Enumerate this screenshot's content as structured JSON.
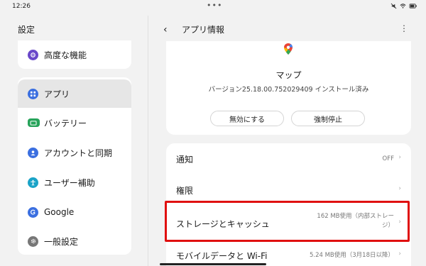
{
  "status_bar": {
    "time": "12:26",
    "dots": "•••"
  },
  "sidebar": {
    "title": "設定",
    "items": [
      {
        "label": "高度な機能",
        "icon": "advanced-features-icon",
        "color": "#6a48c9"
      },
      {
        "label": "アプリ",
        "icon": "apps-grid-icon",
        "color": "#3b6fe0",
        "active": true
      },
      {
        "label": "バッテリー",
        "icon": "battery-icon",
        "color": "#27a35a"
      },
      {
        "label": "アカウントと同期",
        "icon": "account-icon",
        "color": "#3b6fe0"
      },
      {
        "label": "ユーザー補助",
        "icon": "accessibility-icon",
        "color": "#1aa3c7"
      },
      {
        "label": "Google",
        "icon": "google-icon",
        "color": "#3b6fe0"
      },
      {
        "label": "一般設定",
        "icon": "gear-icon",
        "color": "#777777"
      }
    ]
  },
  "header": {
    "back": "‹",
    "title": "アプリ情報",
    "more": "⋮"
  },
  "app": {
    "name": "マップ",
    "version": "バージョン25.18.00.752029409 インストール済み",
    "disable_label": "無効にする",
    "force_stop_label": "強制停止"
  },
  "settings": {
    "notifications": {
      "label": "通知",
      "value": "OFF"
    },
    "permissions": {
      "label": "権限"
    },
    "storage": {
      "label": "ストレージとキャッシュ",
      "value_line1": "162 MB使用（内部ストレー",
      "value_line2": "ジ）"
    },
    "mobile_data": {
      "label": "モバイルデータと Wi-Fi",
      "value": "5.24 MB使用（3月18日以降）"
    },
    "chevron": "›"
  },
  "colors": {
    "accent_highlight": "#e01010",
    "background": "#f2f2f2",
    "card": "#ffffff"
  }
}
